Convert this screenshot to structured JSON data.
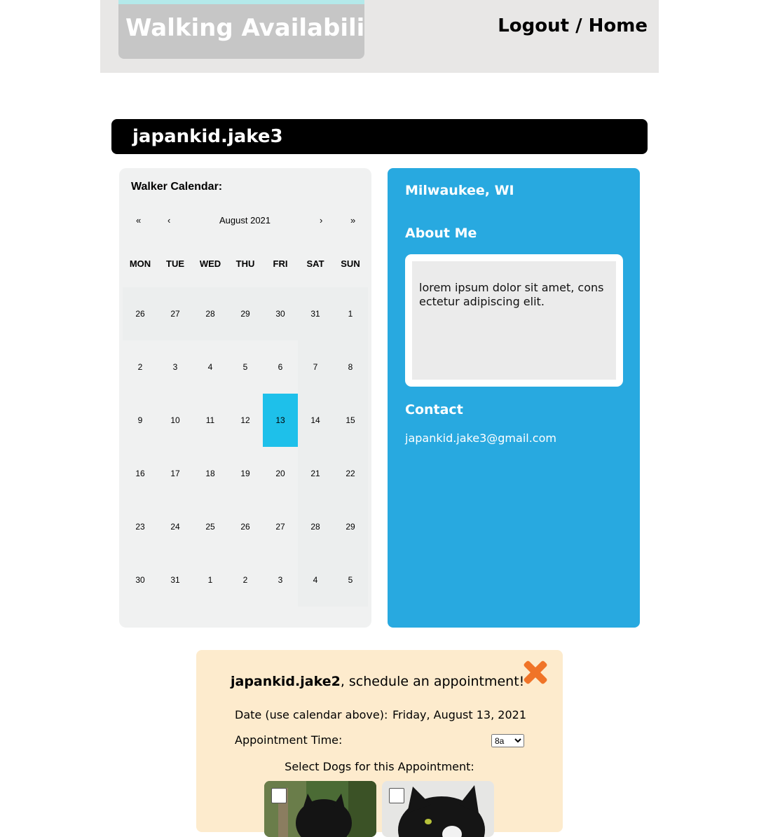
{
  "header": {
    "title": "Walking Availability",
    "logout_label": "Logout",
    "separator": " / ",
    "home_label": "Home"
  },
  "profile": {
    "username": "japankid.jake3"
  },
  "calendar": {
    "heading": "Walker Calendar:",
    "nav_prev_year": "«",
    "nav_prev_month": "‹",
    "month_label": "August 2021",
    "nav_next_month": "›",
    "nav_next_year": "»",
    "weekdays": [
      "MON",
      "TUE",
      "WED",
      "THU",
      "FRI",
      "SAT",
      "SUN"
    ],
    "weeks": [
      [
        "26",
        "27",
        "28",
        "29",
        "30",
        "31",
        "1"
      ],
      [
        "2",
        "3",
        "4",
        "5",
        "6",
        "7",
        "8"
      ],
      [
        "9",
        "10",
        "11",
        "12",
        "13",
        "14",
        "15"
      ],
      [
        "16",
        "17",
        "18",
        "19",
        "20",
        "21",
        "22"
      ],
      [
        "23",
        "24",
        "25",
        "26",
        "27",
        "28",
        "29"
      ],
      [
        "30",
        "31",
        "1",
        "2",
        "3",
        "4",
        "5"
      ]
    ],
    "selected_day": "13"
  },
  "info": {
    "location": "Milwaukee, WI",
    "about_heading": "About Me",
    "about_text": "lorem ipsum dolor sit amet, consectetur adipiscing elit.",
    "contact_heading": "Contact",
    "email": "japankid.jake3@gmail.com"
  },
  "appointment": {
    "requester": "japankid.jake2",
    "title_suffix": ", schedule an appointment!",
    "date_label": "Date (use calendar above):",
    "date_value": "Friday, August 13, 2021",
    "time_label": "Appointment Time:",
    "time_value": "8a",
    "dogs_label": "Select Dogs for this Appointment:",
    "close_icon": "close-x-icon"
  },
  "colors": {
    "header_bg": "#e8e7e6",
    "title_box": "#c6c6c6",
    "title_stripe": "#b4e9ea",
    "calendar_bg": "#f0f1f1",
    "selected_day": "#1ec0ea",
    "info_panel": "#28a9e0",
    "appointment_bg": "#fdebcd",
    "close_icon": "#f07428"
  }
}
